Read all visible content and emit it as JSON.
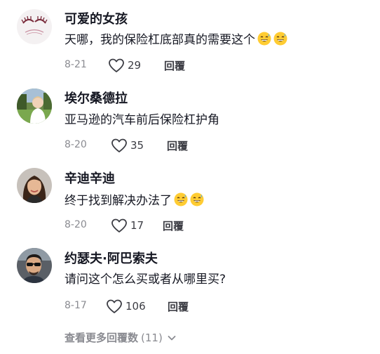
{
  "comments": [
    {
      "username": "可爱的女孩",
      "text": "天哪，我的保险杠底部真的需要这个",
      "emoji": "😅😅",
      "date": "8-21",
      "likes": "29",
      "reply_label": "回覆",
      "avatar_icon": "eyelash-logo-icon"
    },
    {
      "username": "埃尔桑德拉",
      "text": "亚马逊的汽车前后保险杠护角",
      "date": "8-20",
      "likes": "35",
      "reply_label": "回覆",
      "avatar_icon": "user-photo-icon"
    },
    {
      "username": "辛迪辛迪",
      "text": "终于找到解决办法了",
      "emoji": "😅😅",
      "date": "8-20",
      "likes": "17",
      "reply_label": "回覆",
      "avatar_icon": "user-photo-icon"
    },
    {
      "username": "约瑟夫·阿巴索夫",
      "text": "请问这个怎么买或者从哪里买?",
      "date": "8-17",
      "likes": "106",
      "reply_label": "回覆",
      "avatar_icon": "user-photo-icon"
    }
  ],
  "view_more": {
    "label": "查看更多回覆数",
    "count": "(11)"
  },
  "colors": {
    "text_primary": "#161823",
    "text_secondary": "#8a8b91",
    "action": "#3c3d44"
  }
}
